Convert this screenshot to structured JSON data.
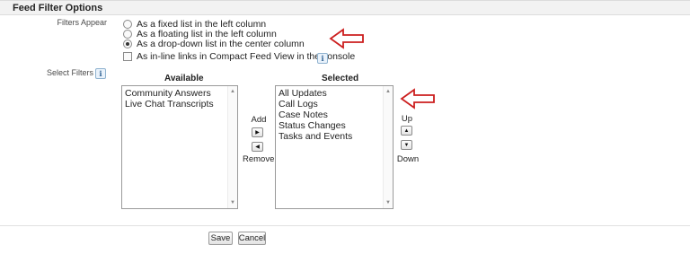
{
  "section": {
    "title": "Feed Filter Options"
  },
  "filters_appear": {
    "label": "Filters Appear",
    "options": [
      {
        "label": "As a fixed list in the left column",
        "checked": false
      },
      {
        "label": "As a floating list in the left column",
        "checked": false
      },
      {
        "label": "As a drop-down list in the center column",
        "checked": true
      }
    ],
    "console_checkbox": {
      "label": "As in-line links in Compact Feed View in the console",
      "checked": false
    }
  },
  "select_filters": {
    "label": "Select Filters",
    "available": {
      "heading": "Available",
      "items": [
        "Community Answers",
        "Live Chat Transcripts"
      ]
    },
    "selected": {
      "heading": "Selected",
      "items": [
        "All Updates",
        "Call Logs",
        "Case Notes",
        "Status Changes",
        "Tasks and Events"
      ]
    },
    "add_label": "Add",
    "remove_label": "Remove",
    "up_label": "Up",
    "down_label": "Down"
  },
  "icons": {
    "info": "i",
    "add_arrow": "▶",
    "remove_arrow": "◀",
    "up_arrow": "▲",
    "down_arrow": "▼",
    "scroll_up": "▲",
    "scroll_down": "▼"
  },
  "footer": {
    "save_label": "Save",
    "cancel_label": "Cancel"
  },
  "colors": {
    "annotation_arrow": "#cc1f1f",
    "header_bg": "#f2f2f2"
  }
}
